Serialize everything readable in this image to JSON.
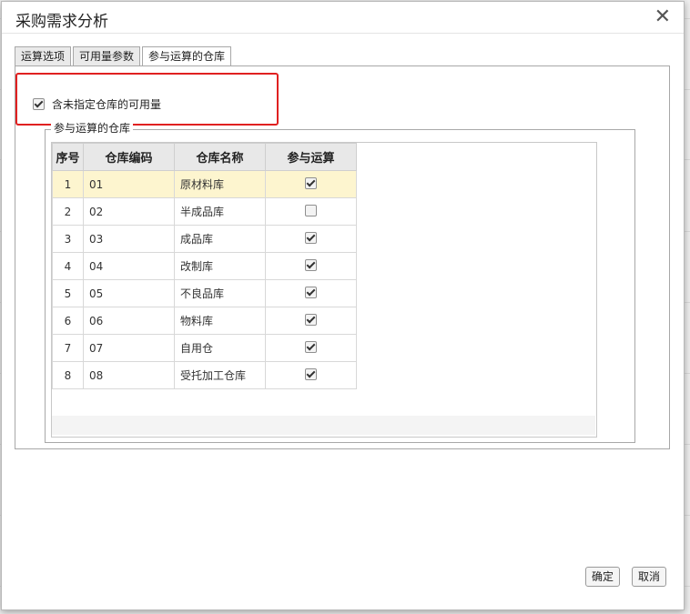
{
  "dialog": {
    "title": "采购需求分析",
    "close_symbol": "✕"
  },
  "tabs": [
    {
      "label": "运算选项",
      "active": false
    },
    {
      "label": "可用量参数",
      "active": false
    },
    {
      "label": "参与运算的仓库",
      "active": true
    }
  ],
  "option": {
    "label": "含未指定仓库的可用量",
    "checked": true
  },
  "group": {
    "legend": "参与运算的仓库"
  },
  "table": {
    "headers": [
      "序号",
      "仓库编码",
      "仓库名称",
      "参与运算"
    ],
    "rows": [
      {
        "no": "1",
        "code": "01",
        "name": "原材料库",
        "checked": true,
        "selected": true
      },
      {
        "no": "2",
        "code": "02",
        "name": "半成品库",
        "checked": false,
        "selected": false
      },
      {
        "no": "3",
        "code": "03",
        "name": "成品库",
        "checked": true,
        "selected": false
      },
      {
        "no": "4",
        "code": "04",
        "name": "改制库",
        "checked": true,
        "selected": false
      },
      {
        "no": "5",
        "code": "05",
        "name": "不良品库",
        "checked": true,
        "selected": false
      },
      {
        "no": "6",
        "code": "06",
        "name": "物料库",
        "checked": true,
        "selected": false
      },
      {
        "no": "7",
        "code": "07",
        "name": "自用仓",
        "checked": true,
        "selected": false
      },
      {
        "no": "8",
        "code": "08",
        "name": "受托加工仓库",
        "checked": true,
        "selected": false
      }
    ]
  },
  "buttons": {
    "ok": "确定",
    "cancel": "取消"
  },
  "colors": {
    "highlight": "#e02020",
    "selected_row": "#fdf5cf"
  }
}
